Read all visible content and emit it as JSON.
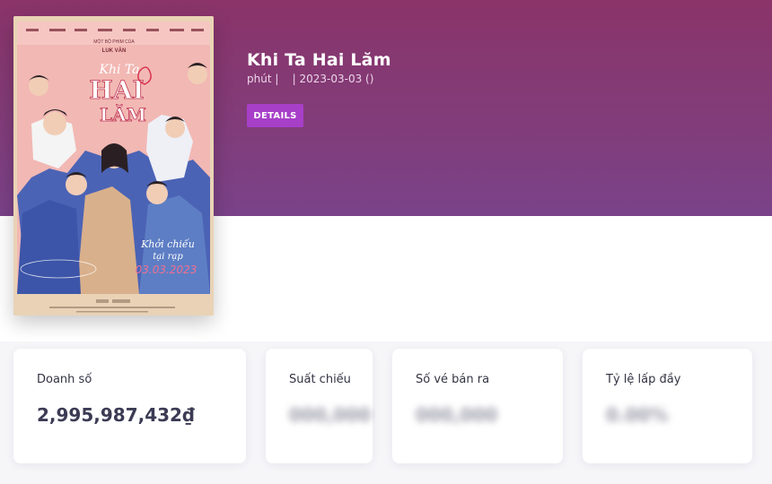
{
  "movie": {
    "title": "Khi Ta Hai Lăm",
    "meta": "phút |    | 2023-03-03 ()",
    "details_label": "DETAILS",
    "poster": {
      "title_top": "Khi Ta",
      "title_main": "HAI",
      "title_bottom": "LĂM",
      "director_caption": "MỘT BỘ PHIM CỦA",
      "director": "LUK VĂN",
      "release_line1": "Khởi chiếu",
      "release_line2": "tại rạp",
      "release_date": "03.03.2023"
    }
  },
  "stats": [
    {
      "label": "Doanh số",
      "value": "2,995,987,432₫"
    },
    {
      "label": "Suất chiếu",
      "value": "000,000"
    },
    {
      "label": "Số vé bán ra",
      "value": "000,000"
    },
    {
      "label": "Tỷ lệ lấp đầy",
      "value": "0.00%"
    }
  ],
  "colors": {
    "hero_top": "#8a3469",
    "hero_bottom": "#7a4289",
    "button": "#a73fc8",
    "value_text": "#3b3b55"
  }
}
